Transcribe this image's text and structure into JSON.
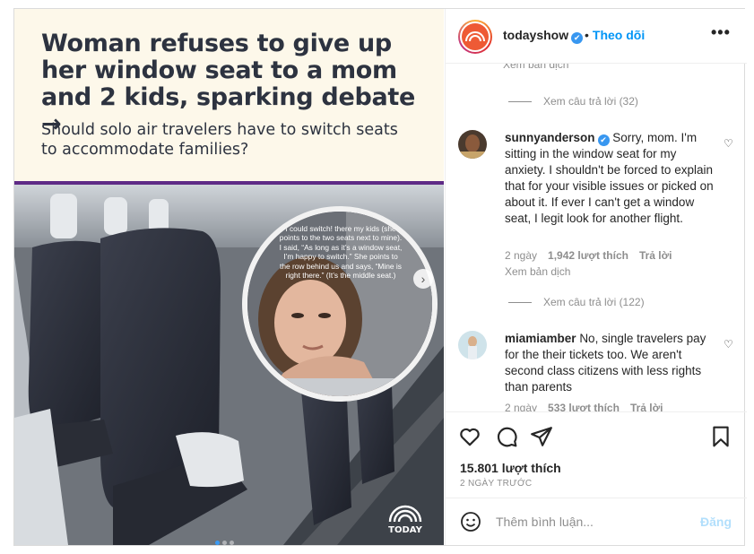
{
  "media": {
    "headline": "Woman refuses to give up her window seat to a mom and 2 kids, sparking debate →",
    "subhead": "Should solo air travelers have to switch seats to accommodate families?",
    "circle_text": "I could switch! there my kids (she points to the two seats next to mine). I said, “As long as it’s a window seat, I’m happy to switch.” She points to the row behind us and says, “Mine is right there.” (It’s the middle seat.)",
    "logo_text": "TODAY",
    "next_icon": "›"
  },
  "header": {
    "username": "todayshow",
    "verified_icon": "✔",
    "follow_sep": "•",
    "follow_label": "Theo dõi",
    "more_icon": "•••"
  },
  "comments": {
    "cut_text": "Xem bản dịch",
    "replies_1": "Xem câu trả lời (32)",
    "items": [
      {
        "username": "sunnyanderson",
        "verified": true,
        "text": "Sorry, mom. I'm sitting in the window seat for my anxiety. I shouldn't be forced to explain that for your visible issues or picked on about it. If ever I can't get a window seat, I legit look for another flight.",
        "time": "2 ngày",
        "likes": "1,942 lượt thích",
        "reply": "Trả lời",
        "translate": "Xem bản dịch",
        "replies": "Xem câu trả lời (122)"
      },
      {
        "username": "miamiamber",
        "verified": false,
        "text": "No, single travelers pay for the their tickets too. We aren't second class citizens with less rights than parents",
        "time": "2 ngày",
        "likes": "533 lượt thích",
        "reply": "Trả lời"
      }
    ],
    "heart_icon": "♡"
  },
  "actions": {
    "likes": "15.801 lượt thích",
    "ago": "2 NGÀY TRƯỚC"
  },
  "compose": {
    "placeholder": "Thêm bình luận...",
    "post_label": "Đăng"
  },
  "colors": {
    "accent": "#0095f6",
    "headline_bg": "#fdf8ea",
    "purple_rule": "#5e2a86"
  }
}
